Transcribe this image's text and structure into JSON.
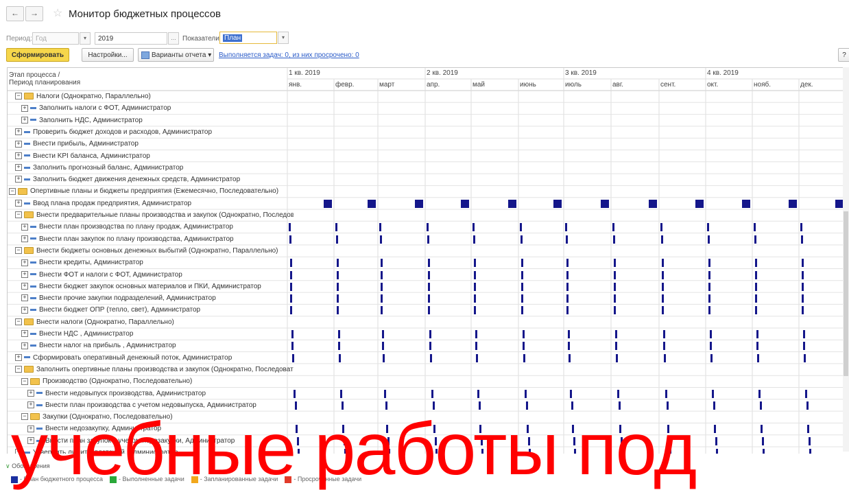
{
  "window": {
    "title": "Монитор бюджетных процессов",
    "back": "←",
    "forward": "→"
  },
  "filters": {
    "period_label": "Период:",
    "period_value": "Год",
    "year_value": "2019",
    "indicators_label": "Показатели:",
    "indicators_value": "План"
  },
  "toolbar": {
    "generate": "Сформировать",
    "settings": "Настройки...",
    "variants": "Варианты отчета",
    "tasks_link": "Выполняется задач: 0, из них просрочено: 0",
    "help": "?"
  },
  "grid_header": {
    "stage_line1": "Этап процесса /",
    "stage_line2": "Период планирования",
    "quarters": [
      "1 кв. 2019",
      "2 кв. 2019",
      "3 кв. 2019",
      "4 кв. 2019"
    ],
    "months": [
      "янв.",
      "февр.",
      "март",
      "апр.",
      "май",
      "июнь",
      "июль",
      "авг.",
      "сент.",
      "окт.",
      "нояб.",
      "дек."
    ]
  },
  "rows": [
    {
      "label": "Налоги (Однократно, Параллельно)",
      "level": 1,
      "kind": "group",
      "mark": null
    },
    {
      "label": "Заполнить налоги с ФОТ, Администратор",
      "level": 2,
      "kind": "task",
      "mark": null
    },
    {
      "label": "Заполнить НДС, Администратор",
      "level": 2,
      "kind": "task",
      "mark": null
    },
    {
      "label": "Проверить бюджет доходов и расходов, Администратор",
      "level": 1,
      "kind": "task",
      "mark": null
    },
    {
      "label": "Внести прибыль, Администратор",
      "level": 1,
      "kind": "task",
      "mark": null
    },
    {
      "label": "Внести KPI баланса, Администратор",
      "level": 1,
      "kind": "task",
      "mark": null
    },
    {
      "label": "Заполнить прогнозный баланс, Администратор",
      "level": 1,
      "kind": "task",
      "mark": null
    },
    {
      "label": "Заполнить бюджет движения денежных средств, Администратор",
      "level": 1,
      "kind": "task",
      "mark": null
    },
    {
      "label": "Опертивные планы и бюджеты предприятия (Ежемесячно, Последовательно)",
      "level": 0,
      "kind": "group",
      "mark": null
    },
    {
      "label": "Ввод плана продаж предприятия, Администратор",
      "level": 1,
      "kind": "task",
      "mark": "square"
    },
    {
      "label": "Внести предварительные планы производства и закупок (Однократно, Последовательно)",
      "level": 1,
      "kind": "group",
      "mark": null
    },
    {
      "label": "Внести план производства по плану продаж, Администратор",
      "level": 2,
      "kind": "task",
      "mark": "bar",
      "mark_day": 0.5
    },
    {
      "label": "Внести план закупок по плану производства, Администратор",
      "level": 2,
      "kind": "task",
      "mark": "bar",
      "mark_day": 1
    },
    {
      "label": "Внести бюджеты основных денежных выбытий (Однократно, Параллельно)",
      "level": 1,
      "kind": "group",
      "mark": null
    },
    {
      "label": "Внести кредиты, Администратор",
      "level": 2,
      "kind": "task",
      "mark": "bar",
      "mark_day": 2
    },
    {
      "label": "Внести ФОТ и налоги с ФОТ, Администратор",
      "level": 2,
      "kind": "task",
      "mark": "bar",
      "mark_day": 2
    },
    {
      "label": "Внести бюджет закупок основных материалов и ПКИ, Администратор",
      "level": 2,
      "kind": "task",
      "mark": "bar",
      "mark_day": 2
    },
    {
      "label": "Внести прочие закупки подразделений, Администратор",
      "level": 2,
      "kind": "task",
      "mark": "bar",
      "mark_day": 2
    },
    {
      "label": "Внести бюджет ОПР (тепло, свет), Администратор",
      "level": 2,
      "kind": "task",
      "mark": "bar",
      "mark_day": 2
    },
    {
      "label": "Внести налоги (Однократно, Параллельно)",
      "level": 1,
      "kind": "group",
      "mark": null
    },
    {
      "label": "Внести НДС , Администратор",
      "level": 2,
      "kind": "task",
      "mark": "bar",
      "mark_day": 3
    },
    {
      "label": "Внести налог на прибыль , Администратор",
      "level": 2,
      "kind": "task",
      "mark": "bar",
      "mark_day": 3
    },
    {
      "label": "Сформировать оперативный денежный поток, Администратор",
      "level": 1,
      "kind": "task",
      "mark": "bar",
      "mark_day": 4
    },
    {
      "label": "Заполнить опертивные планы производства и закупок (Однократно, Последовательно)",
      "level": 1,
      "kind": "group",
      "mark": null
    },
    {
      "label": "Производство (Однократно, Последовательно)",
      "level": 2,
      "kind": "group",
      "mark": null
    },
    {
      "label": "Внести недовыпуск производства, Администратор",
      "level": 3,
      "kind": "task",
      "mark": "bar",
      "mark_day": 5
    },
    {
      "label": "Внести план производства с учетом недовыпуска, Администратор",
      "level": 3,
      "kind": "task",
      "mark": "bar",
      "mark_day": 6
    },
    {
      "label": "Закупки (Однократно, Последовательно)",
      "level": 2,
      "kind": "group",
      "mark": null
    },
    {
      "label": "Внести недозакупку, Администратор",
      "level": 3,
      "kind": "task",
      "mark": "bar",
      "mark_day": 7
    },
    {
      "label": "Внести план закупок с учетом недозакупки, Администратор",
      "level": 3,
      "kind": "task",
      "mark": "bar",
      "mark_day": 8
    },
    {
      "label": "Утвердить лимиты платежей, Администратор",
      "level": 1,
      "kind": "task",
      "mark": "bar",
      "mark_day": 9
    }
  ],
  "legend": {
    "title": "Обозначения",
    "items": [
      {
        "text": "- План бюджетного процесса",
        "color": "#1a2fa0"
      },
      {
        "text": "- Выполненные задачи",
        "color": "#2aa83a"
      },
      {
        "text": "- Запланированные задачи",
        "color": "#f2a81c"
      },
      {
        "text": "- Просроченные задачи",
        "color": "#e23b2a"
      }
    ]
  },
  "watermark": "учебные работы под",
  "colors": {
    "mark": "#14168a",
    "accent": "#f6d64b",
    "link": "#2a5bc8"
  }
}
